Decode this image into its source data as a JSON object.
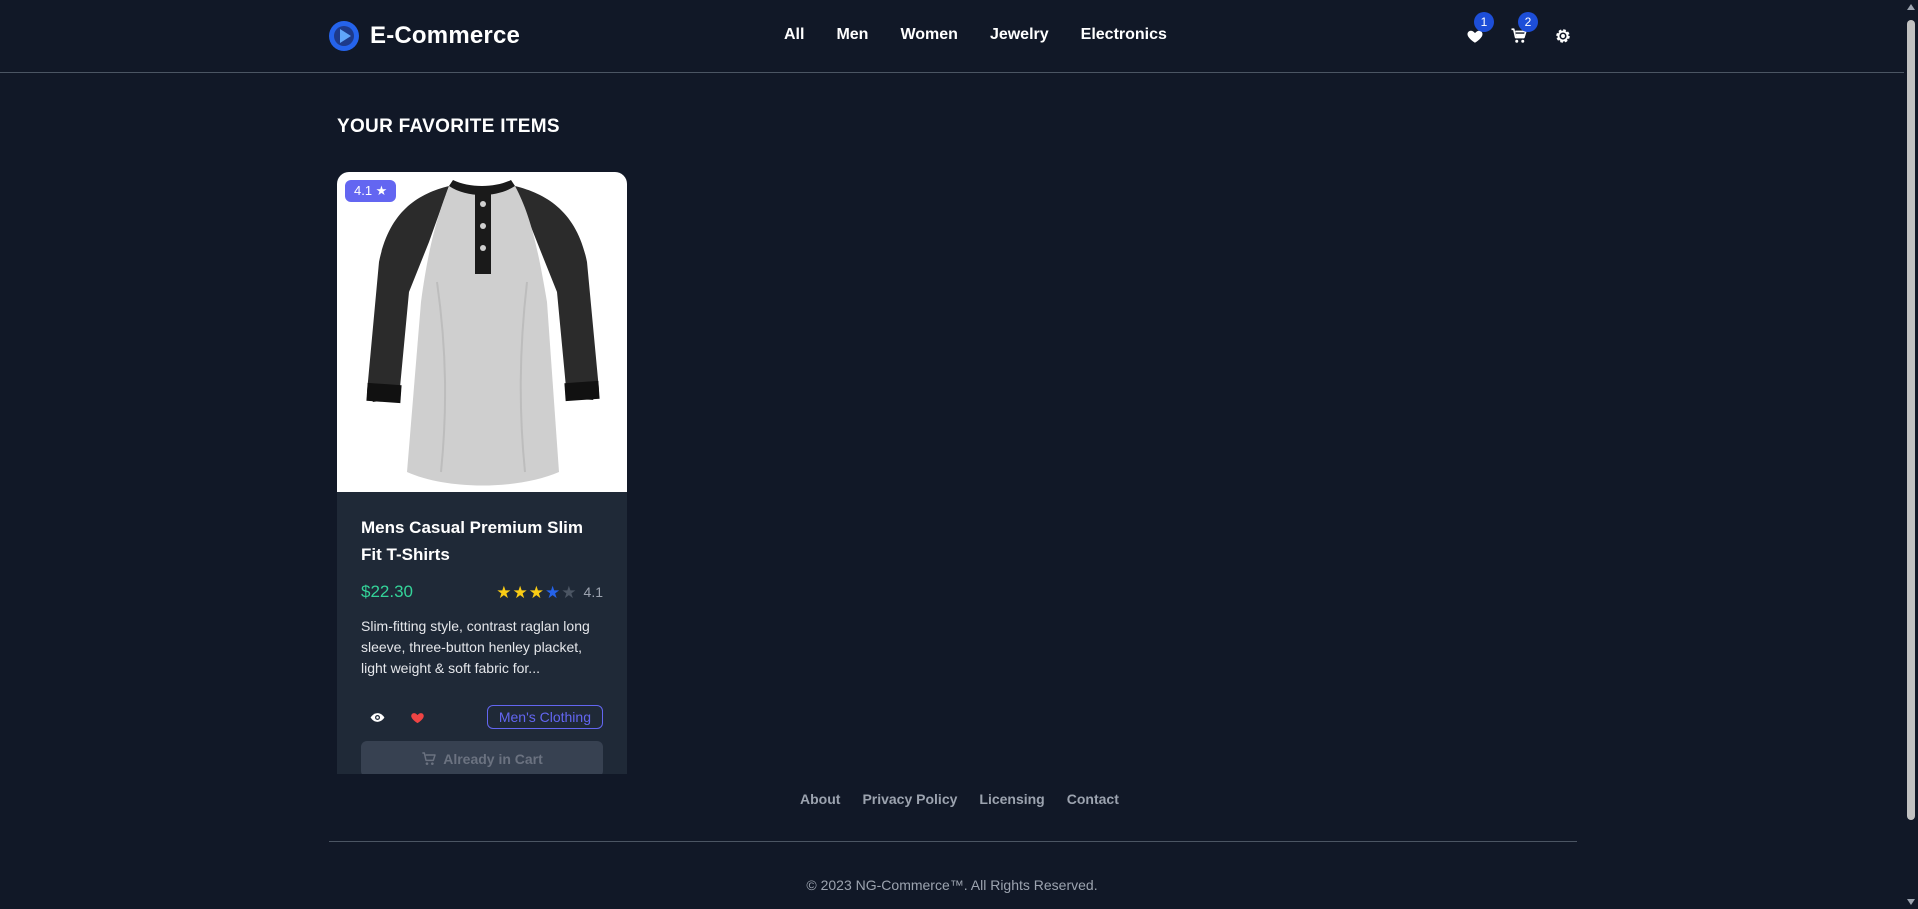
{
  "brand": {
    "name": "E-Commerce"
  },
  "nav": {
    "items": [
      "All",
      "Men",
      "Women",
      "Jewelry",
      "Electronics"
    ]
  },
  "header_actions": {
    "wishlist_count": "1",
    "cart_count": "2"
  },
  "main": {
    "section_title": "YOUR FAVORITE ITEMS",
    "product": {
      "rating_badge": "4.1 ★",
      "title": "Mens Casual Premium Slim Fit T-Shirts",
      "price": "$22.30",
      "rating": 4.1,
      "rating_text": "4.1",
      "description": "Slim-fitting style, contrast raglan long sleeve, three-button henley placket, light weight & soft fabric for...",
      "category": "Men's Clothing",
      "cart_button": "Already in Cart"
    }
  },
  "footer": {
    "links": [
      "About",
      "Privacy Policy",
      "Licensing",
      "Contact"
    ],
    "copyright": "© 2023 NG-Commerce™. All Rights Reserved."
  },
  "icons": {
    "wishlist": "heart-icon",
    "cart": "cart-icon",
    "settings": "gear-icon",
    "view": "eye-icon",
    "favorite": "heart-icon"
  },
  "colors": {
    "background": "#111827",
    "card": "#1f2937",
    "accent": "#6366f1",
    "price": "#34d399",
    "badge": "#1d4ed8",
    "favorite": "#ef4444"
  }
}
